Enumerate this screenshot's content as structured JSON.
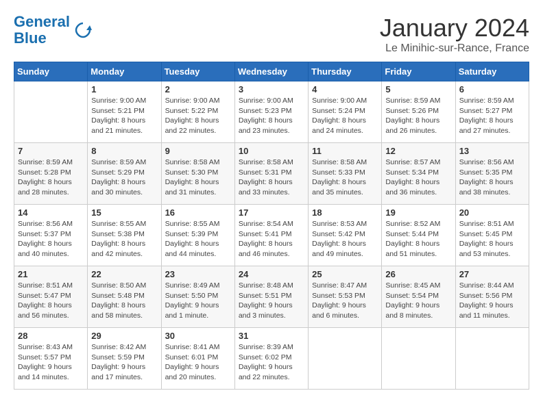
{
  "logo": {
    "line1": "General",
    "line2": "Blue"
  },
  "title": "January 2024",
  "location": "Le Minihic-sur-Rance, France",
  "days_header": [
    "Sunday",
    "Monday",
    "Tuesday",
    "Wednesday",
    "Thursday",
    "Friday",
    "Saturday"
  ],
  "weeks": [
    [
      {
        "num": "",
        "info": ""
      },
      {
        "num": "1",
        "info": "Sunrise: 9:00 AM\nSunset: 5:21 PM\nDaylight: 8 hours\nand 21 minutes."
      },
      {
        "num": "2",
        "info": "Sunrise: 9:00 AM\nSunset: 5:22 PM\nDaylight: 8 hours\nand 22 minutes."
      },
      {
        "num": "3",
        "info": "Sunrise: 9:00 AM\nSunset: 5:23 PM\nDaylight: 8 hours\nand 23 minutes."
      },
      {
        "num": "4",
        "info": "Sunrise: 9:00 AM\nSunset: 5:24 PM\nDaylight: 8 hours\nand 24 minutes."
      },
      {
        "num": "5",
        "info": "Sunrise: 8:59 AM\nSunset: 5:26 PM\nDaylight: 8 hours\nand 26 minutes."
      },
      {
        "num": "6",
        "info": "Sunrise: 8:59 AM\nSunset: 5:27 PM\nDaylight: 8 hours\nand 27 minutes."
      }
    ],
    [
      {
        "num": "7",
        "info": "Sunrise: 8:59 AM\nSunset: 5:28 PM\nDaylight: 8 hours\nand 28 minutes."
      },
      {
        "num": "8",
        "info": "Sunrise: 8:59 AM\nSunset: 5:29 PM\nDaylight: 8 hours\nand 30 minutes."
      },
      {
        "num": "9",
        "info": "Sunrise: 8:58 AM\nSunset: 5:30 PM\nDaylight: 8 hours\nand 31 minutes."
      },
      {
        "num": "10",
        "info": "Sunrise: 8:58 AM\nSunset: 5:31 PM\nDaylight: 8 hours\nand 33 minutes."
      },
      {
        "num": "11",
        "info": "Sunrise: 8:58 AM\nSunset: 5:33 PM\nDaylight: 8 hours\nand 35 minutes."
      },
      {
        "num": "12",
        "info": "Sunrise: 8:57 AM\nSunset: 5:34 PM\nDaylight: 8 hours\nand 36 minutes."
      },
      {
        "num": "13",
        "info": "Sunrise: 8:56 AM\nSunset: 5:35 PM\nDaylight: 8 hours\nand 38 minutes."
      }
    ],
    [
      {
        "num": "14",
        "info": "Sunrise: 8:56 AM\nSunset: 5:37 PM\nDaylight: 8 hours\nand 40 minutes."
      },
      {
        "num": "15",
        "info": "Sunrise: 8:55 AM\nSunset: 5:38 PM\nDaylight: 8 hours\nand 42 minutes."
      },
      {
        "num": "16",
        "info": "Sunrise: 8:55 AM\nSunset: 5:39 PM\nDaylight: 8 hours\nand 44 minutes."
      },
      {
        "num": "17",
        "info": "Sunrise: 8:54 AM\nSunset: 5:41 PM\nDaylight: 8 hours\nand 46 minutes."
      },
      {
        "num": "18",
        "info": "Sunrise: 8:53 AM\nSunset: 5:42 PM\nDaylight: 8 hours\nand 49 minutes."
      },
      {
        "num": "19",
        "info": "Sunrise: 8:52 AM\nSunset: 5:44 PM\nDaylight: 8 hours\nand 51 minutes."
      },
      {
        "num": "20",
        "info": "Sunrise: 8:51 AM\nSunset: 5:45 PM\nDaylight: 8 hours\nand 53 minutes."
      }
    ],
    [
      {
        "num": "21",
        "info": "Sunrise: 8:51 AM\nSunset: 5:47 PM\nDaylight: 8 hours\nand 56 minutes."
      },
      {
        "num": "22",
        "info": "Sunrise: 8:50 AM\nSunset: 5:48 PM\nDaylight: 8 hours\nand 58 minutes."
      },
      {
        "num": "23",
        "info": "Sunrise: 8:49 AM\nSunset: 5:50 PM\nDaylight: 9 hours\nand 1 minute."
      },
      {
        "num": "24",
        "info": "Sunrise: 8:48 AM\nSunset: 5:51 PM\nDaylight: 9 hours\nand 3 minutes."
      },
      {
        "num": "25",
        "info": "Sunrise: 8:47 AM\nSunset: 5:53 PM\nDaylight: 9 hours\nand 6 minutes."
      },
      {
        "num": "26",
        "info": "Sunrise: 8:45 AM\nSunset: 5:54 PM\nDaylight: 9 hours\nand 8 minutes."
      },
      {
        "num": "27",
        "info": "Sunrise: 8:44 AM\nSunset: 5:56 PM\nDaylight: 9 hours\nand 11 minutes."
      }
    ],
    [
      {
        "num": "28",
        "info": "Sunrise: 8:43 AM\nSunset: 5:57 PM\nDaylight: 9 hours\nand 14 minutes."
      },
      {
        "num": "29",
        "info": "Sunrise: 8:42 AM\nSunset: 5:59 PM\nDaylight: 9 hours\nand 17 minutes."
      },
      {
        "num": "30",
        "info": "Sunrise: 8:41 AM\nSunset: 6:01 PM\nDaylight: 9 hours\nand 20 minutes."
      },
      {
        "num": "31",
        "info": "Sunrise: 8:39 AM\nSunset: 6:02 PM\nDaylight: 9 hours\nand 22 minutes."
      },
      {
        "num": "",
        "info": ""
      },
      {
        "num": "",
        "info": ""
      },
      {
        "num": "",
        "info": ""
      }
    ]
  ]
}
